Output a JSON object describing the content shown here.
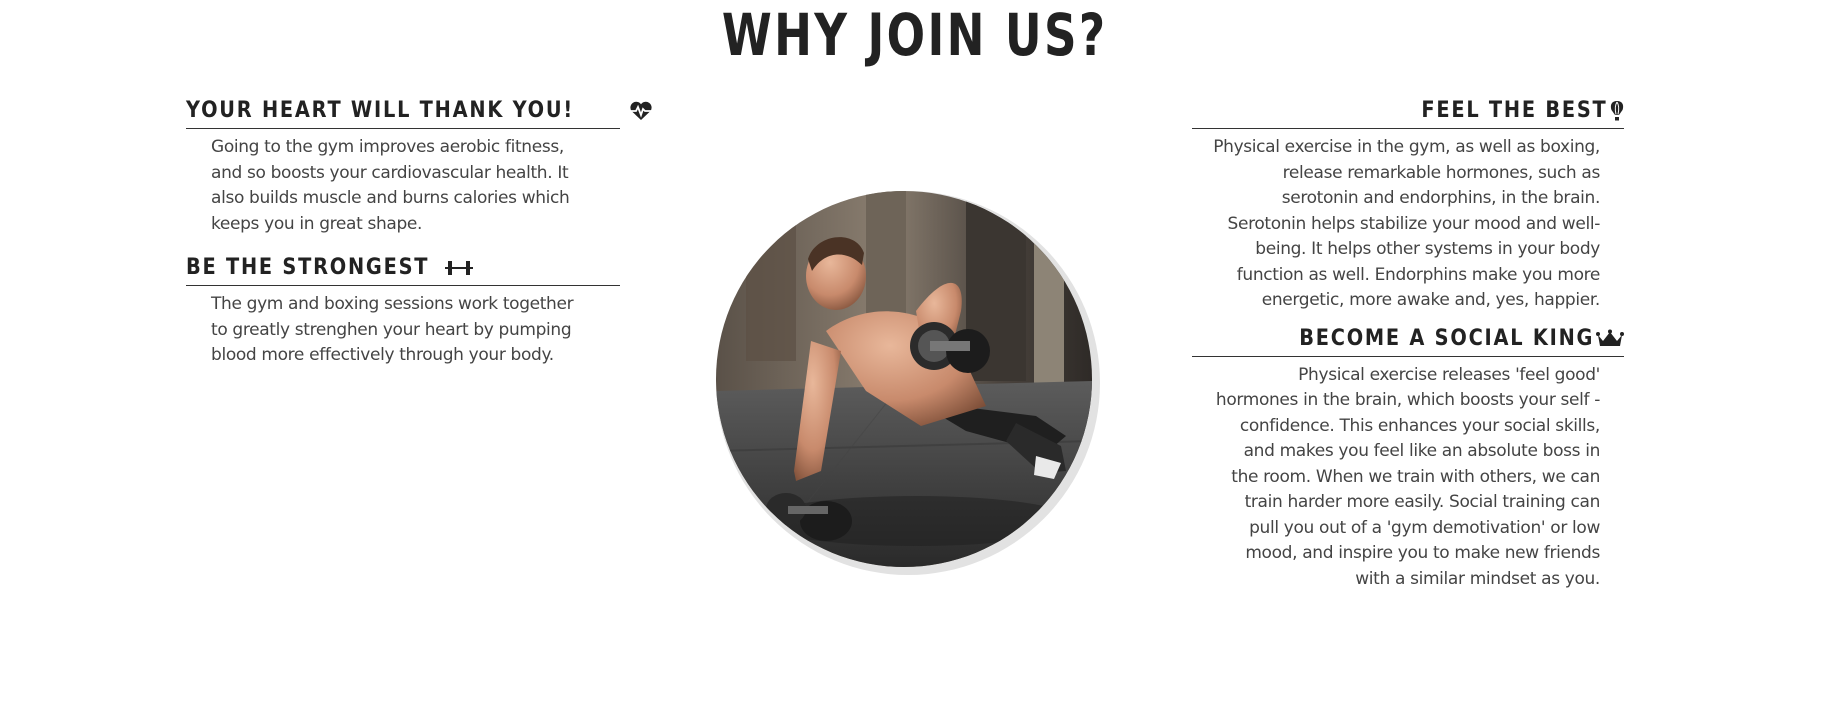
{
  "page": {
    "title": "WHY JOIN US?"
  },
  "left_sections": [
    {
      "heading": "YOUR HEART WILL THANK YOU!",
      "icon": "heartbeat-icon",
      "body": "Going to the gym improves aerobic fitness, and so boosts your cardiovascular health. It also builds muscle and burns calories which keeps you in great shape."
    },
    {
      "heading": "BE THE STRONGEST",
      "icon": "dumbbell-icon",
      "body": "The gym and boxing sessions work together to greatly strenghen your heart by pumping blood more effectively through your body."
    }
  ],
  "right_sections": [
    {
      "heading": "FEEL THE BEST",
      "icon": "hot-air-balloon-icon",
      "body": "Physical exercise in the gym, as well as boxing, release remarkable hormones, such as serotonin and endorphins, in the brain. Serotonin helps stabilize your mood and well-being. It helps other systems in your body function as well. Endorphins make you more energetic, more awake and, yes, happier."
    },
    {
      "heading": "BECOME A SOCIAL KING",
      "icon": "crown-icon",
      "body": "Physical exercise releases 'feel good' hormones in the brain, which boosts your self - confidence. This enhances your social skills, and makes you feel like an absolute boss in the room. When we train with others, we can train harder more easily. Social training can pull you out of a 'gym demotivation' or low mood, and inspire you to make new friends with a similar mindset as you."
    }
  ],
  "photo": {
    "subject": "man-doing-dumbbell-push-up-photo"
  },
  "colors": {
    "heading": "#222222",
    "body_text": "#444444",
    "rule": "#333333",
    "background": "#ffffff"
  }
}
